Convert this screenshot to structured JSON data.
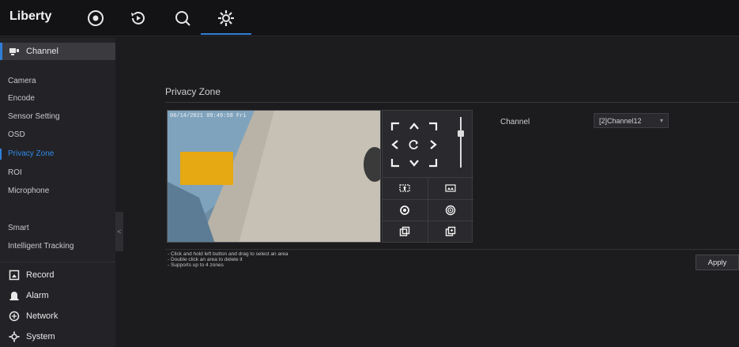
{
  "app": {
    "logo": "Liberty"
  },
  "topnav": {
    "icons": [
      "live-view-icon",
      "playback-icon",
      "search-icon",
      "settings-icon"
    ],
    "active": "settings-icon",
    "accent": "#2f7fd8"
  },
  "sidebar": {
    "channel_header": "Channel",
    "channel_items": [
      "Camera",
      "Encode",
      "Sensor Setting",
      "OSD",
      "Privacy Zone",
      "ROI",
      "Microphone"
    ],
    "active_item": "Privacy Zone",
    "smart_items": [
      "Smart",
      "Intelligent Tracking"
    ],
    "groups": [
      {
        "label": "Record",
        "icon": "record-icon"
      },
      {
        "label": "Alarm",
        "icon": "alarm-icon"
      },
      {
        "label": "Network",
        "icon": "network-icon"
      },
      {
        "label": "System",
        "icon": "system-icon"
      }
    ],
    "collapse_glyph": "<"
  },
  "main": {
    "title": "Privacy Zone",
    "video": {
      "timestamp": "06/14/2021 09:49:58 Fri",
      "zone_color": "#e6a813"
    },
    "channel": {
      "label": "Channel",
      "value": "[2]Channel12"
    },
    "tips": [
      "- Click and hold left button and drag to select an area",
      "- Double click an area to delete it",
      "- Supports up to 4 zones"
    ],
    "apply_label": "Apply"
  }
}
